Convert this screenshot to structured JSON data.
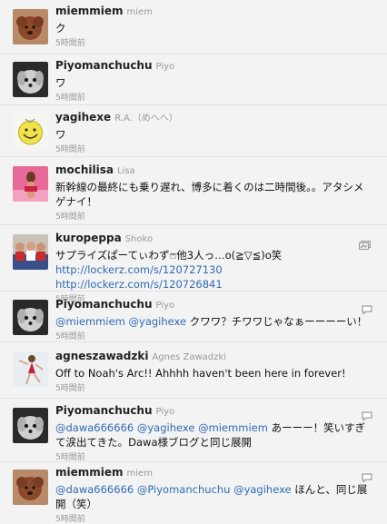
{
  "tweets": [
    {
      "name": "miemmiem",
      "fullname": "miem",
      "segments": [
        {
          "t": "ク",
          "link": false
        }
      ],
      "time": "5時間前",
      "avatar": "poodle"
    },
    {
      "name": "Piyomanchuchu",
      "fullname": "Piyo",
      "segments": [
        {
          "t": "ワ",
          "link": false
        }
      ],
      "time": "5時間前",
      "avatar": "fluffy"
    },
    {
      "name": "yagihexe",
      "fullname": "R.A.（めへへ）",
      "segments": [
        {
          "t": "ワ",
          "link": false
        }
      ],
      "time": "5時間前",
      "avatar": "smiley"
    },
    {
      "name": "mochilisa",
      "fullname": "Lisa",
      "segments": [
        {
          "t": "新幹線の最終にも乗り遅れ、博多に着くのは二時間後。。アタシメゲナイ！",
          "link": false
        }
      ],
      "time": "5時間前",
      "avatar": "pink-photo"
    },
    {
      "name": "kuropeppa",
      "fullname": "Shoko",
      "segments": [
        {
          "t": "サプライズぱーてぃわずෆ他3人っ…o(≧▽≦)o笑 ",
          "link": false
        },
        {
          "t": "http://lockerz.com/s/120727130",
          "link": true
        },
        {
          "t": " ",
          "link": false
        },
        {
          "t": "http://lockerz.com/s/120726841",
          "link": true
        }
      ],
      "time": "5時間前",
      "avatar": "group-photo"
    },
    {
      "name": "Piyomanchuchu",
      "fullname": "Piyo",
      "segments": [
        {
          "t": "@miemmiem",
          "link": true
        },
        {
          "t": " ",
          "link": false
        },
        {
          "t": "@yagihexe",
          "link": true
        },
        {
          "t": " クワワ？チワワじゃなぁーーーーい！",
          "link": false
        }
      ],
      "time": "5時間前",
      "avatar": "fluffy"
    },
    {
      "name": "agneszawadzki",
      "fullname": "Agnes Zawadzki",
      "segments": [
        {
          "t": "Off to Noah's Arc!! Ahhhh haven't been here in forever!",
          "link": false
        }
      ],
      "time": "5時間前",
      "avatar": "skater"
    },
    {
      "name": "Piyomanchuchu",
      "fullname": "Piyo",
      "segments": [
        {
          "t": "@dawa666666",
          "link": true
        },
        {
          "t": " ",
          "link": false
        },
        {
          "t": "@yagihexe",
          "link": true
        },
        {
          "t": " ",
          "link": false
        },
        {
          "t": "@miemmiem",
          "link": true
        },
        {
          "t": " あーーー！笑いすぎて涙出てきた。Dawa様ブログと同じ展開",
          "link": false
        }
      ],
      "time": "5時間前",
      "avatar": "fluffy"
    },
    {
      "name": "miemmiem",
      "fullname": "miem",
      "segments": [
        {
          "t": "@dawa666666",
          "link": true
        },
        {
          "t": " ",
          "link": false
        },
        {
          "t": "@Piyomanchuchu",
          "link": true
        },
        {
          "t": " ",
          "link": false
        },
        {
          "t": "@yagihexe",
          "link": true
        },
        {
          "t": " ほんと、同じ展開（笑）",
          "link": false
        }
      ],
      "time": "5時間前",
      "avatar": "poodle"
    }
  ],
  "icons": {
    "reply": "reply-bubble-icon",
    "media": "media-gallery-icon"
  },
  "colors": {
    "link": "#2f6bb2",
    "background": "#f3f3f3",
    "meta": "#9a9a9a"
  }
}
